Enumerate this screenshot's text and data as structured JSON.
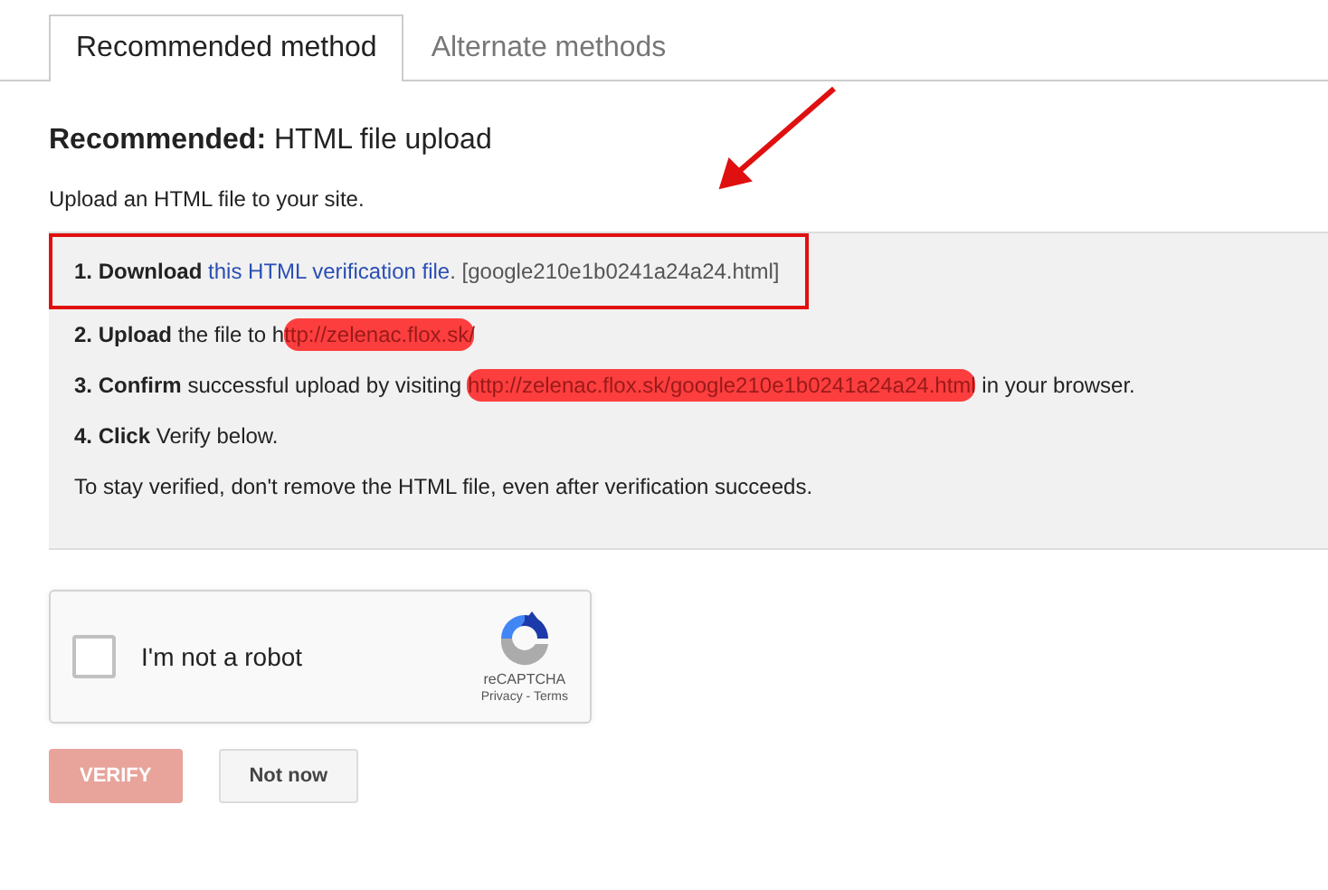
{
  "tabs": [
    {
      "label": "Recommended method",
      "selected": true
    },
    {
      "label": "Alternate methods",
      "selected": false
    }
  ],
  "heading": {
    "bold": "Recommended:",
    "text": "HTML file upload"
  },
  "intro": "Upload an HTML file to your site.",
  "steps": [
    {
      "highlighted": true,
      "segments": [
        {
          "kind": "bold",
          "text": "1. Download"
        },
        {
          "kind": "link",
          "text": "this HTML verification file"
        },
        {
          "kind": "muted",
          "text": ". [google210e1b0241a24a24.html]"
        }
      ]
    },
    {
      "highlighted": false,
      "segments": [
        {
          "kind": "bold",
          "text": "2. Upload"
        },
        {
          "kind": "text",
          "text": "the file to h"
        },
        {
          "kind": "scribbled",
          "text": "ttp://zelenac.flox.sk/"
        }
      ]
    },
    {
      "highlighted": false,
      "segments": [
        {
          "kind": "bold",
          "text": "3. Confirm"
        },
        {
          "kind": "text",
          "text": "successful upload by visiting"
        },
        {
          "kind": "scribbled",
          "text": "http://zelenac.flox.sk/google210e1b0241a24a24.html"
        },
        {
          "kind": "text",
          "text": "in your browser."
        }
      ]
    },
    {
      "highlighted": false,
      "segments": [
        {
          "kind": "bold",
          "text": "4. Click"
        },
        {
          "kind": "text",
          "text": "Verify below."
        }
      ]
    },
    {
      "highlighted": false,
      "segments": [
        {
          "kind": "text",
          "text": "To stay verified, don't remove the HTML file, even after verification succeeds."
        }
      ]
    }
  ],
  "annotation_arrow": true,
  "captcha": {
    "label": "I'm not a robot",
    "checked": false,
    "brand": "reCAPTCHA",
    "privacy": "Privacy",
    "separator": " - ",
    "terms": "Terms"
  },
  "buttons": [
    {
      "label": "VERIFY",
      "kind": "primary",
      "disabled": true
    },
    {
      "label": "Not now",
      "kind": "secondary",
      "disabled": false
    }
  ]
}
